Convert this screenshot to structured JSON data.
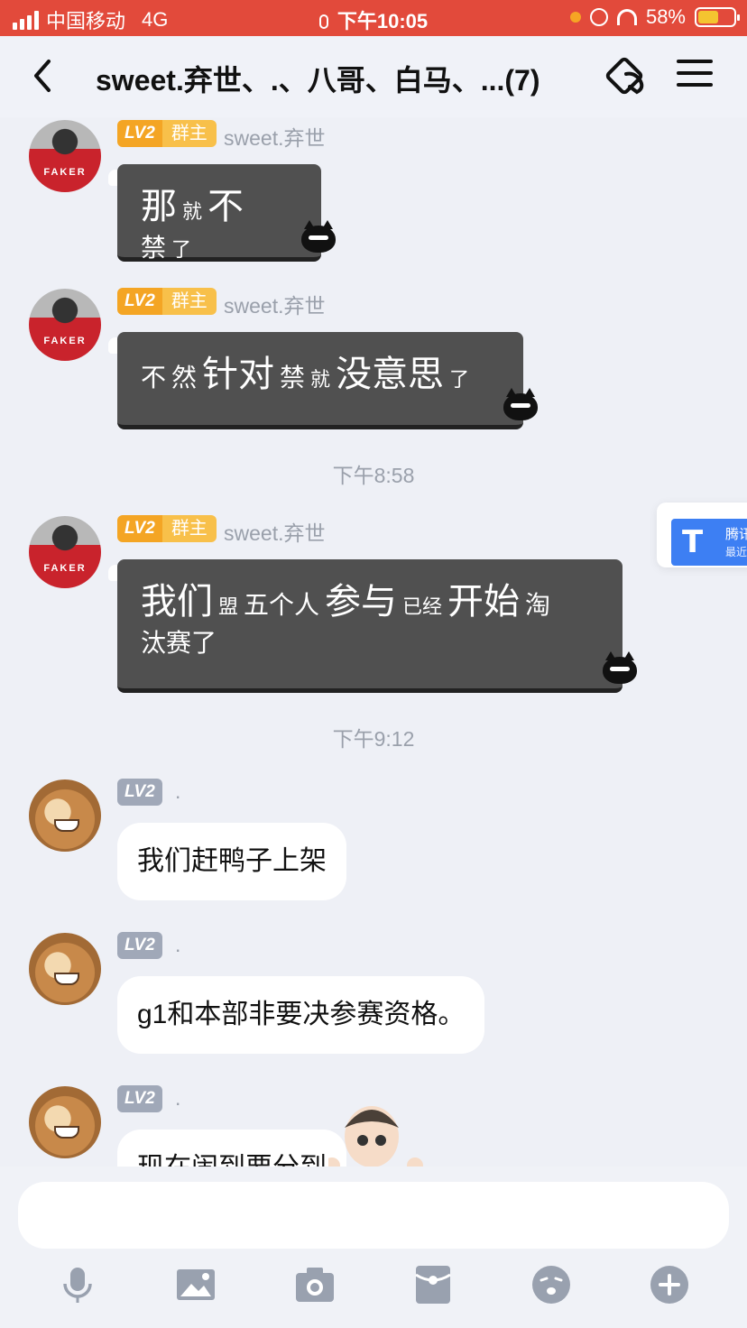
{
  "status_bar": {
    "carrier": "中国移动",
    "network": "4G",
    "time": "下午10:05",
    "battery": "58%",
    "battery_level": 0.58
  },
  "header": {
    "title": "sweet.弃世、.、八哥、白马、...(7)"
  },
  "messages": [
    {
      "sender": "sweet.弃世",
      "level": "LV2",
      "role": "群主",
      "segments": [
        {
          "t": "那",
          "s": "lg"
        },
        {
          "t": "就",
          "s": "sm"
        },
        {
          "t": "不",
          "s": "lg"
        },
        {
          "t": "禁",
          "s": "md"
        },
        {
          "t": "了",
          "s": "sm"
        }
      ]
    },
    {
      "sender": "sweet.弃世",
      "level": "LV2",
      "role": "群主",
      "segments": [
        {
          "t": "不",
          "s": "md"
        },
        {
          "t": "然",
          "s": "md"
        },
        {
          "t": "针对",
          "s": "lg"
        },
        {
          "t": "禁",
          "s": "md"
        },
        {
          "t": "就",
          "s": "sm"
        },
        {
          "t": "没意思",
          "s": "lg"
        },
        {
          "t": "了",
          "s": "sm"
        }
      ]
    },
    {
      "timestamp": "下午8:58"
    },
    {
      "sender": "sweet.弃世",
      "level": "LV2",
      "role": "群主",
      "segments": [
        {
          "t": "我们",
          "s": "lg"
        },
        {
          "t": "盟",
          "s": "sm"
        },
        {
          "t": "五个人",
          "s": "md"
        },
        {
          "t": "参与",
          "s": "lg"
        },
        {
          "t": "已经",
          "s": "sm"
        },
        {
          "t": "开始",
          "s": "lg"
        },
        {
          "t": "淘",
          "s": "md"
        },
        {
          "t": "汰赛了",
          "s": "md"
        }
      ]
    },
    {
      "timestamp": "下午9:12"
    },
    {
      "sender": ".",
      "level": "LV2",
      "text": "我们赶鸭子上架"
    },
    {
      "sender": ".",
      "level": "LV2",
      "text": "g1和本部非要决参赛资格。"
    },
    {
      "sender": ".",
      "level": "LV2",
      "text": "现在闹到要分到"
    }
  ],
  "floating_app": {
    "title": "腾讯",
    "subtitle": "最近"
  },
  "input": {
    "value": "",
    "placeholder": ""
  },
  "toolbar": [
    "mic-icon",
    "image-icon",
    "camera-icon",
    "red-packet-icon",
    "emoji-icon",
    "plus-icon"
  ]
}
